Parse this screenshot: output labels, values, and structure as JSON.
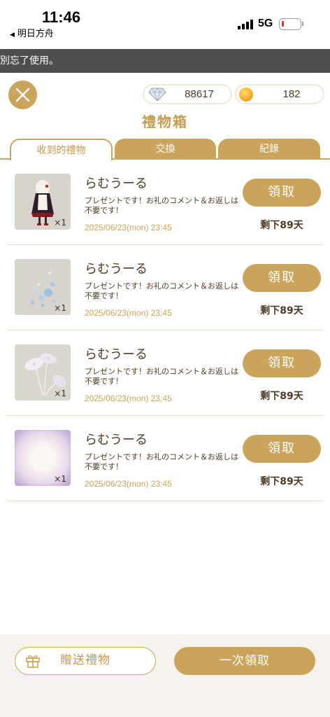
{
  "status_bar": {
    "time": "11:46",
    "back_app": "明日方舟",
    "network": "5G",
    "battery_level": 0.1
  },
  "notice": "別忘了使用。",
  "header": {
    "gems": "88617",
    "coins": "182",
    "title": "禮物箱"
  },
  "tabs": [
    {
      "label": "收到的禮物",
      "active": true
    },
    {
      "label": "交換",
      "active": false
    },
    {
      "label": "紀錄",
      "active": false
    }
  ],
  "gifts": [
    {
      "sender": "らむうーる",
      "message": "プレゼントです！お礼のコメント＆お返しは不要です！",
      "date": "2025/06/23(mon) 23:45",
      "quantity": "×1",
      "claim_label": "領取",
      "remaining": "剩下89天",
      "item_icon": "doll-figure"
    },
    {
      "sender": "らむうーる",
      "message": "プレゼントです！お礼のコメント＆お返しは不要です！",
      "date": "2025/06/23(mon) 23:45",
      "quantity": "×1",
      "claim_label": "領取",
      "remaining": "剩下89天",
      "item_icon": "bubbles"
    },
    {
      "sender": "らむうーる",
      "message": "プレゼントです！お礼のコメント＆お返しは不要です！",
      "date": "2025/06/23(mon) 23:45",
      "quantity": "×1",
      "claim_label": "領取",
      "remaining": "剩下89天",
      "item_icon": "flowers"
    },
    {
      "sender": "らむうーる",
      "message": "プレゼントです！お礼のコメント＆お返しは不要です！",
      "date": "2025/06/23(mon) 23:45",
      "quantity": "×1",
      "claim_label": "領取",
      "remaining": "剩下89天",
      "item_icon": "purple-glow-frame"
    }
  ],
  "footer": {
    "send_label": "贈送禮物",
    "claim_all_label": "一次領取"
  },
  "colors": {
    "accent": "#c9a45a",
    "text": "#4d3a25",
    "notice_bg": "#4e4e4e"
  }
}
